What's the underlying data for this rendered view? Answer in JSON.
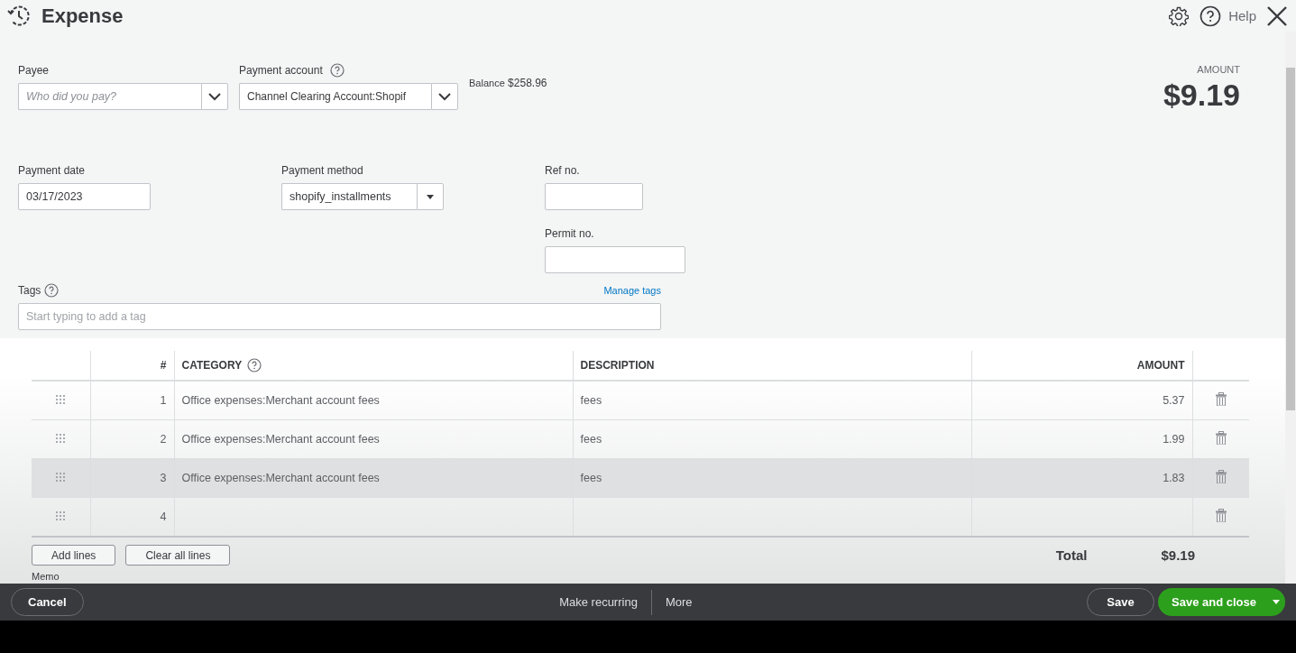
{
  "header": {
    "title": "Expense",
    "help_label": "Help"
  },
  "payee": {
    "label": "Payee",
    "placeholder": "Who did you pay?"
  },
  "payment_account": {
    "label": "Payment account",
    "value": "Channel Clearing Account:Shopif",
    "balance_label": "Balance",
    "balance": "$258.96"
  },
  "amount": {
    "label": "AMOUNT",
    "value": "$9.19"
  },
  "payment_date": {
    "label": "Payment date",
    "value": "03/17/2023"
  },
  "payment_method": {
    "label": "Payment method",
    "value": "shopify_installments"
  },
  "ref_no": {
    "label": "Ref no."
  },
  "permit_no": {
    "label": "Permit no."
  },
  "tags": {
    "label": "Tags",
    "placeholder": "Start typing to add a tag",
    "manage_link": "Manage tags"
  },
  "table": {
    "columns": [
      "#",
      "CATEGORY",
      "DESCRIPTION",
      "AMOUNT"
    ],
    "rows": [
      {
        "number": "1",
        "category": "Office expenses:Merchant account fees",
        "description": "fees",
        "amount": "5.37",
        "hovered": false
      },
      {
        "number": "2",
        "category": "Office expenses:Merchant account fees",
        "description": "fees",
        "amount": "1.99",
        "hovered": false
      },
      {
        "number": "3",
        "category": "Office expenses:Merchant account fees",
        "description": "fees",
        "amount": "1.83",
        "hovered": true
      },
      {
        "number": "4",
        "hovered": false
      }
    ]
  },
  "line_buttons": [
    "Add lines",
    "Clear all lines"
  ],
  "total": {
    "label": "Total",
    "value": "$9.19"
  },
  "memo_label": "Memo",
  "footer": {
    "cancel": "Cancel",
    "make_recurring": "Make recurring",
    "more": "More",
    "save": "Save",
    "save_and_close": "Save and close"
  }
}
